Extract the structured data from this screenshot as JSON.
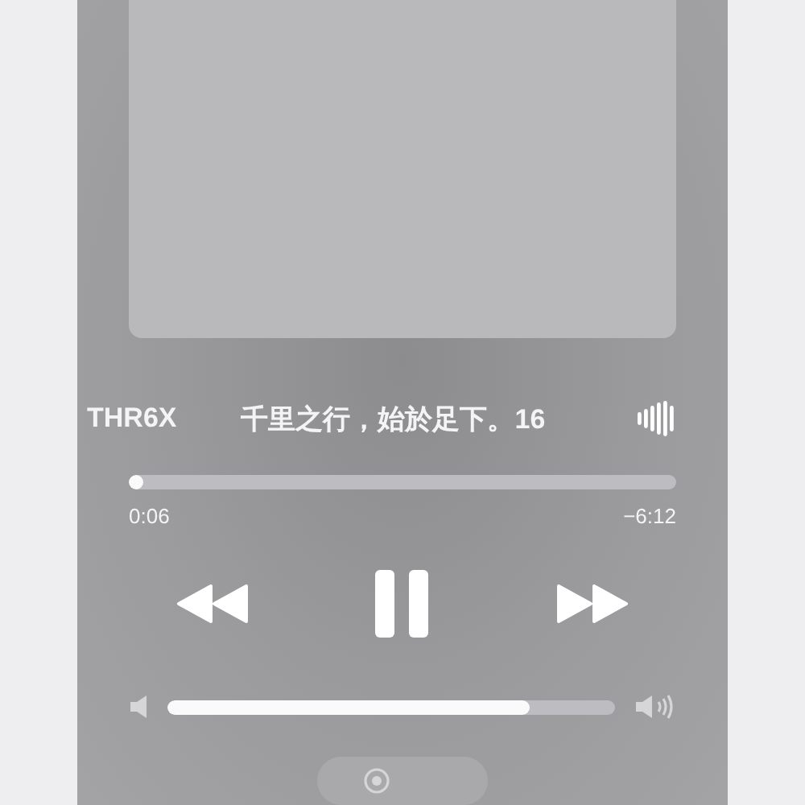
{
  "now_playing": {
    "artist": "THR6X",
    "title": "千里之行，始於足下。16"
  },
  "progress": {
    "level": 0.02,
    "elapsed": "0:06",
    "remaining": "−6:12"
  },
  "playback": {
    "playing": true
  },
  "volume": {
    "level": 0.81
  }
}
